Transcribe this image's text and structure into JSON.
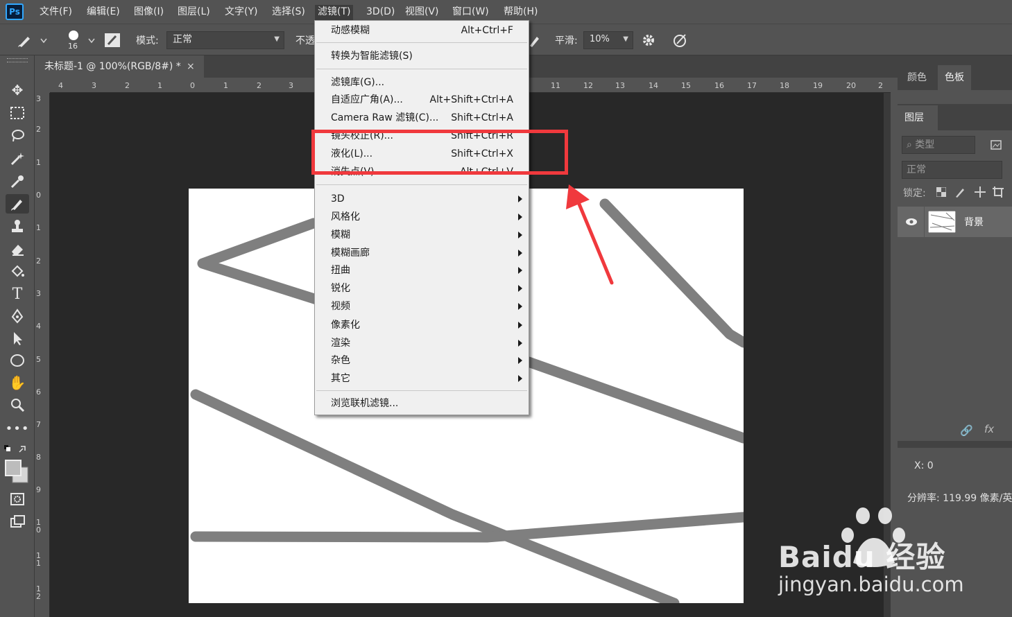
{
  "app": {
    "logo": "Ps"
  },
  "menubar": {
    "items": [
      {
        "label": "文件(F)"
      },
      {
        "label": "编辑(E)"
      },
      {
        "label": "图像(I)"
      },
      {
        "label": "图层(L)"
      },
      {
        "label": "文字(Y)"
      },
      {
        "label": "选择(S)"
      },
      {
        "label": "滤镜(T)",
        "active": true
      },
      {
        "label": "3D(D)"
      },
      {
        "label": "视图(V)"
      },
      {
        "label": "窗口(W)"
      },
      {
        "label": "帮助(H)"
      }
    ]
  },
  "options": {
    "brush_size": "16",
    "mode_label": "模式:",
    "mode_value": "正常",
    "opacity_label": "不透",
    "smoothing_label": "平滑:",
    "smoothing_value": "10%"
  },
  "document": {
    "tab_title": "未标题-1 @ 100%(RGB/8#) *",
    "close_glyph": "×"
  },
  "ruler_h_labels": [
    "4",
    "3",
    "2",
    "1",
    "0",
    "1",
    "2",
    "3",
    "11",
    "12",
    "13",
    "14",
    "15",
    "16",
    "17",
    "18",
    "19",
    "20",
    "2"
  ],
  "ruler_v_labels": [
    "3",
    "2",
    "1",
    "0",
    "1",
    "2",
    "3",
    "4",
    "5",
    "6",
    "7",
    "8",
    "9",
    "1 0",
    "1 1",
    "1 2"
  ],
  "filter_menu": {
    "items": [
      {
        "label": "动感模糊",
        "shortcut": "Alt+Ctrl+F"
      },
      {
        "label": "转换为智能滤镜(S)",
        "shortcut": ""
      },
      {
        "label": "滤镜库(G)...",
        "shortcut": ""
      },
      {
        "label": "自适应广角(A)...",
        "shortcut": "Alt+Shift+Ctrl+A"
      },
      {
        "label": "Camera Raw 滤镜(C)...",
        "shortcut": "Shift+Ctrl+A"
      },
      {
        "label": "镜头校正(R)...",
        "shortcut": "Shift+Ctrl+R"
      },
      {
        "label": "液化(L)...",
        "shortcut": "Shift+Ctrl+X",
        "highlighted": true
      },
      {
        "label": "消失点(V)...",
        "shortcut": "Alt+Ctrl+V"
      },
      {
        "label": "3D",
        "submenu": true
      },
      {
        "label": "风格化",
        "submenu": true
      },
      {
        "label": "模糊",
        "submenu": true
      },
      {
        "label": "模糊画廊",
        "submenu": true
      },
      {
        "label": "扭曲",
        "submenu": true
      },
      {
        "label": "锐化",
        "submenu": true
      },
      {
        "label": "视频",
        "submenu": true
      },
      {
        "label": "像素化",
        "submenu": true
      },
      {
        "label": "渲染",
        "submenu": true
      },
      {
        "label": "杂色",
        "submenu": true
      },
      {
        "label": "其它",
        "submenu": true
      },
      {
        "label": "浏览联机滤镜...",
        "shortcut": ""
      }
    ]
  },
  "panels": {
    "color_tabs": [
      "颜色",
      "色板"
    ],
    "layers_tab": "图层",
    "filter_kind": "类型",
    "blend_mode": "正常",
    "lock_label": "锁定:",
    "layer_name": "背景",
    "info_x": "X:  0",
    "resolution": "分辨率: 119.99 像素/英"
  },
  "watermark": {
    "brand": "Baidu 经验",
    "url": "jingyan.baidu.com"
  },
  "colors": {
    "annotation_red": "#f0393d",
    "stroke_gray": "#7f7f7f",
    "menu_bg": "#f0f0f0"
  }
}
